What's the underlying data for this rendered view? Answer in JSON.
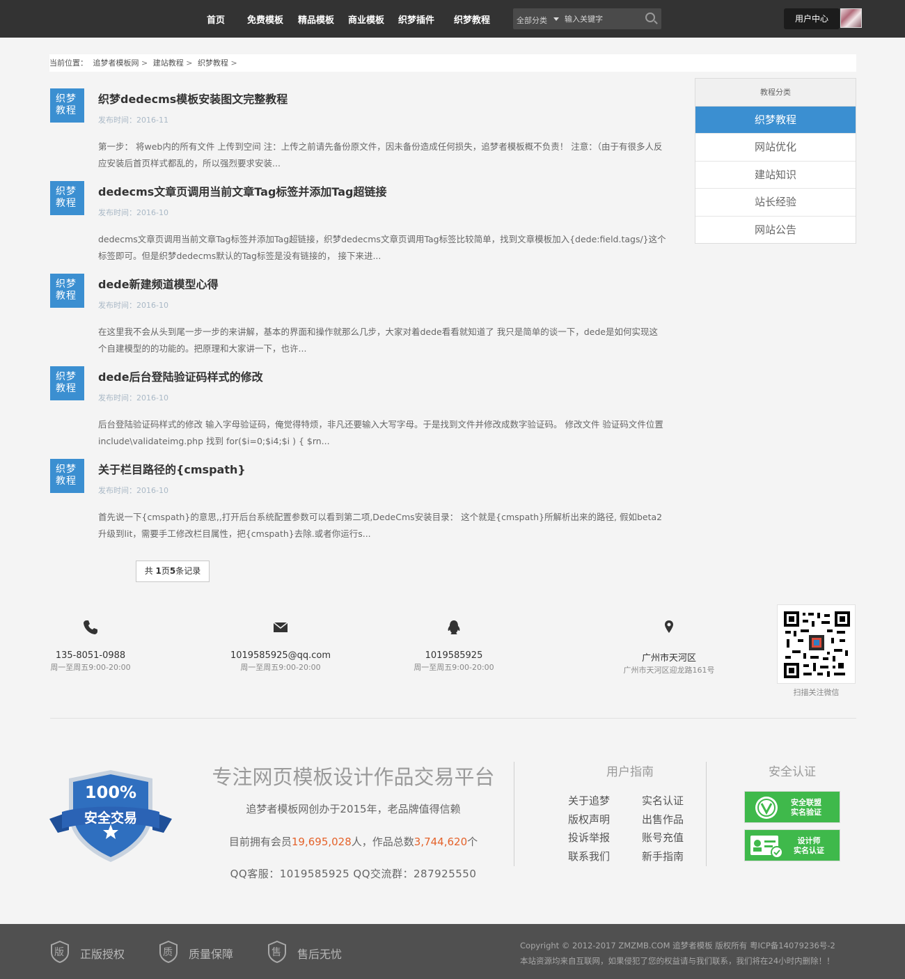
{
  "header": {
    "nav": [
      "首页",
      "免费模板",
      "精品模板",
      "商业模板",
      "织梦插件",
      "织梦教程"
    ],
    "search_category": "全部分类",
    "search_placeholder": "输入关键字",
    "user_center": "用户中心"
  },
  "breadcrumb": {
    "prefix": "当前位置：",
    "items": [
      "追梦者模板网",
      "建站教程",
      "织梦教程"
    ],
    "sep": ">"
  },
  "articles": [
    {
      "badge_line1": "织梦",
      "badge_line2": "教程",
      "title": "织梦dedecms模板安装图文完整教程",
      "date": "发布时间：2016-11",
      "summary": "第一步： 将web内的所有文件 上传到空间 注：上传之前请先备份原文件，因未备份造成任何损失，追梦者模板概不负责！ 注意：（由于有很多人反应安装后首页样式都乱的，所以强烈要求安装..."
    },
    {
      "badge_line1": "织梦",
      "badge_line2": "教程",
      "title": "dedecms文章页调用当前文章Tag标签并添加Tag超链接",
      "date": "发布时间：2016-10",
      "summary": "dedecms文章页调用当前文章Tag标签并添加Tag超链接，织梦dedecms文章页调用Tag标签比较简单，找到文章模板加入{dede:field.tags/}这个标签即可。但是织梦dedecms默认的Tag标签是没有链接的， 接下来进..."
    },
    {
      "badge_line1": "织梦",
      "badge_line2": "教程",
      "title": "dede新建频道模型心得",
      "date": "发布时间：2016-10",
      "summary": "在这里我不会从头到尾一步一步的来讲解，基本的界面和操作就那么几步，大家对着dede看看就知道了 我只是简单的谈一下，dede是如何实现这个自建模型的的功能的。把原理和大家讲一下，也许..."
    },
    {
      "badge_line1": "织梦",
      "badge_line2": "教程",
      "title": "dede后台登陆验证码样式的修改",
      "date": "发布时间：2016-10",
      "summary": "后台登陆验证码样式的修改 输入字母验证码，俺觉得特烦，非凡还要输入大写字母。于是找到文件并修改成数字验证码。 修改文件 验证码文件位置 include\\validateimg.php 找到 for($i=0;$i4;$i ) { $rn..."
    },
    {
      "badge_line1": "织梦",
      "badge_line2": "教程",
      "title": "关于栏目路径的{cmspath}",
      "date": "发布时间：2016-10",
      "summary": "首先说一下{cmspath}的意思,,打开后台系统配置参数可以看到第二项,DedeCms安装目录： 这个就是{cmspath}所解析出来的路径, 假如beta2升级到lit，需要手工修改栏目属性，把{cmspath}去除.或者你运行s..."
    }
  ],
  "pager": {
    "text_prefix": "共 ",
    "pages": "1",
    "text_mid": "页",
    "records": "5",
    "text_suffix": "条记录"
  },
  "sidebar": {
    "title": "教程分类",
    "items": [
      "织梦教程",
      "网站优化",
      "建站知识",
      "站长经验",
      "网站公告"
    ],
    "active_index": 0
  },
  "contacts": [
    {
      "icon": "phone-icon",
      "main": "135-8051-0988",
      "sub": "周一至周五9:00-20:00"
    },
    {
      "icon": "mail-icon",
      "main": "1019585925@qq.com",
      "sub": "周一至周五9:00-20:00"
    },
    {
      "icon": "qq-icon",
      "main": "1019585925",
      "sub": "周一至周五9:00-20:00"
    },
    {
      "icon": "location-icon",
      "main": "广州市天河区",
      "sub": "广州市天河区迎龙路161号"
    }
  ],
  "qr_caption": "扫描关注微信",
  "footer": {
    "shield_top": "100%",
    "shield_mid": "安全交易",
    "slogan": "专注网页模板设计作品交易平台",
    "subslogan": "追梦者模板网创办于2015年，老品牌值得信赖",
    "stats_prefix": "目前拥有会员",
    "members": "19,695,028",
    "stats_mid": "人，作品总数",
    "works": "3,744,620",
    "stats_suffix": "个",
    "qq_line": "QQ客服：1019585925  QQ交流群：287925550",
    "guide_title": "用户指南",
    "guide_links": [
      "关于追梦",
      "实名认证",
      "版权声明",
      "出售作品",
      "投诉举报",
      "账号充值",
      "联系我们",
      "新手指南"
    ],
    "cert_title": "安全认证",
    "certs": [
      {
        "line1": "安全联盟",
        "line2": "实名验证"
      },
      {
        "line1": "设计师",
        "line2": "实名认证"
      }
    ]
  },
  "bottom": {
    "promises": [
      {
        "glyph": "版",
        "label": "正版授权"
      },
      {
        "glyph": "质",
        "label": "质量保障"
      },
      {
        "glyph": "售",
        "label": "售后无忧"
      }
    ],
    "copyright_line1": "Copyright © 2012-2017 ZMZMB.COM 追梦者模板 版权所有 粤ICP备14079236号-2",
    "copyright_line2": "本站资源均来自互联网，如果侵犯了您的权益请与我们联系，我们将在24小时内删除！！"
  },
  "colors": {
    "header_bg": "#333333",
    "accent_blue": "#3b8fd1",
    "orange": "#e4622a",
    "cert_green": "#3fb94b",
    "bottom_bg": "#505050"
  }
}
